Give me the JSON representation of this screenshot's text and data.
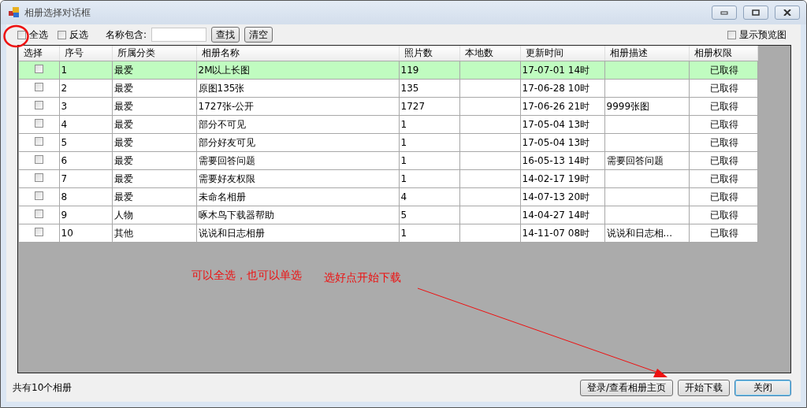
{
  "window": {
    "title": "相册选择对话框"
  },
  "toolbar": {
    "checkboxes": [
      {
        "label": "全选",
        "checked": false
      },
      {
        "label": "反选",
        "checked": false
      }
    ],
    "filter_label": "名称包含:",
    "buttons": [
      "查找",
      "清空"
    ],
    "preview": {
      "label": "显示预览图",
      "checked": false
    }
  },
  "table": {
    "columns": [
      "选择",
      "序号",
      "所属分类",
      "相册名称",
      "照片数",
      "本地数",
      "更新时间",
      "相册描述",
      "相册权限"
    ],
    "rows": [
      {
        "checked": false,
        "selected": true,
        "no": "1",
        "category": "最爱",
        "name": "2M以上长图",
        "photos": "119",
        "updated": "17-07-01 14时",
        "permission": "已取得"
      },
      {
        "checked": false,
        "selected": false,
        "no": "2",
        "category": "最爱",
        "name": "原图135张",
        "photos": "135",
        "updated": "17-06-28 10时",
        "permission": "已取得"
      },
      {
        "checked": false,
        "selected": false,
        "no": "3",
        "category": "最爱",
        "name": "1727张-公开",
        "photos": "1727",
        "updated": "17-06-26 21时",
        "description": "9999张图",
        "permission": "已取得"
      },
      {
        "checked": false,
        "selected": false,
        "no": "4",
        "category": "最爱",
        "name": "部分不可见",
        "photos": "1",
        "updated": "17-05-04 13时",
        "permission": "已取得"
      },
      {
        "checked": false,
        "selected": false,
        "no": "5",
        "category": "最爱",
        "name": "部分好友可见",
        "photos": "1",
        "updated": "17-05-04 13时",
        "permission": "已取得"
      },
      {
        "checked": false,
        "selected": false,
        "no": "6",
        "category": "最爱",
        "name": "需要回答问题",
        "photos": "1",
        "updated": "16-05-13 14时",
        "description": "需要回答问题",
        "permission": "已取得"
      },
      {
        "checked": false,
        "selected": false,
        "no": "7",
        "category": "最爱",
        "name": "需要好友权限",
        "photos": "1",
        "updated": "14-02-17 19时",
        "permission": "已取得"
      },
      {
        "checked": false,
        "selected": false,
        "no": "8",
        "category": "最爱",
        "name": "未命名相册",
        "photos": "4",
        "updated": "14-07-13 20时",
        "permission": "已取得"
      },
      {
        "checked": false,
        "selected": false,
        "no": "9",
        "category": "人物",
        "name": "啄木鸟下载器帮助",
        "photos": "5",
        "updated": "14-04-27 14时",
        "permission": "已取得"
      },
      {
        "checked": false,
        "selected": false,
        "no": "10",
        "category": "其他",
        "name": "说说和日志相册",
        "photos": "1",
        "updated": "14-11-07 08时",
        "description": "说说和日志相...",
        "permission": "已取得"
      }
    ]
  },
  "annotations": [
    "可以全选，也可以单选",
    "选好点开始下载"
  ],
  "status": "共有10个相册",
  "buttons": [
    {
      "label": "登录/查看相册主页",
      "default": false
    },
    {
      "label": "开始下载",
      "default": false
    },
    {
      "label": "关闭",
      "default": true
    }
  ]
}
